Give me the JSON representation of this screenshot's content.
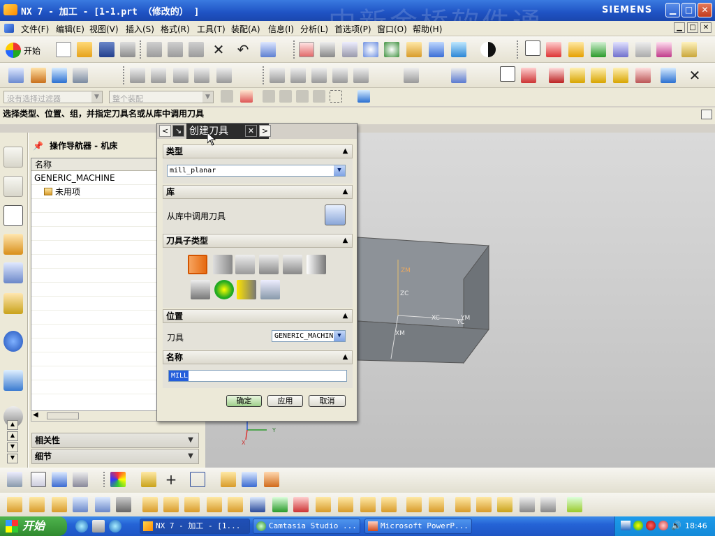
{
  "window": {
    "title": "NX 7 - 加工 - [1-1.prt （修改的） ]",
    "brand": "SIEMENS",
    "watermark": "中新金桥软件通",
    "min_label": "▁",
    "max_label": "□",
    "close_label": "✕"
  },
  "menu": {
    "items": [
      "文件(F)",
      "编辑(E)",
      "视图(V)",
      "插入(S)",
      "格式(R)",
      "工具(T)",
      "装配(A)",
      "信息(I)",
      "分析(L)",
      "首选项(P)",
      "窗口(O)",
      "帮助(H)"
    ],
    "start_label": "开始"
  },
  "filter": {
    "selection_filter": "没有选择过滤器",
    "scope": "整个装配"
  },
  "cue_line": "选择类型、位置、组，并指定刀具名或从库中调用刀具",
  "navigator": {
    "title": "操作导航器 - 机床",
    "column_header": "名称",
    "rows": [
      "GENERIC_MACHINE",
      "未用项"
    ],
    "sections": [
      "相关性",
      "细节"
    ]
  },
  "dialog": {
    "title": "创建刀具",
    "sections": {
      "type": "类型",
      "library": "库",
      "subtype": "刀具子类型",
      "location": "位置",
      "name": "名称"
    },
    "type_value": "mill_planar",
    "library_label": "从库中调用刀具",
    "location_label": "刀具",
    "location_value": "GENERIC_MACHINE",
    "name_value": "MILL",
    "ok_label": "确定",
    "apply_label": "应用",
    "cancel_label": "取消"
  },
  "viewport": {
    "wcs_labels": [
      "ZM",
      "ZC",
      "XC",
      "YC",
      "YM",
      "XM",
      "Y",
      "X"
    ]
  },
  "taskbar": {
    "start": "开始",
    "tasks": [
      "NX 7 - 加工 - [1...",
      "Camtasia Studio ...",
      "Microsoft PowerP..."
    ],
    "clock": "18:46"
  }
}
